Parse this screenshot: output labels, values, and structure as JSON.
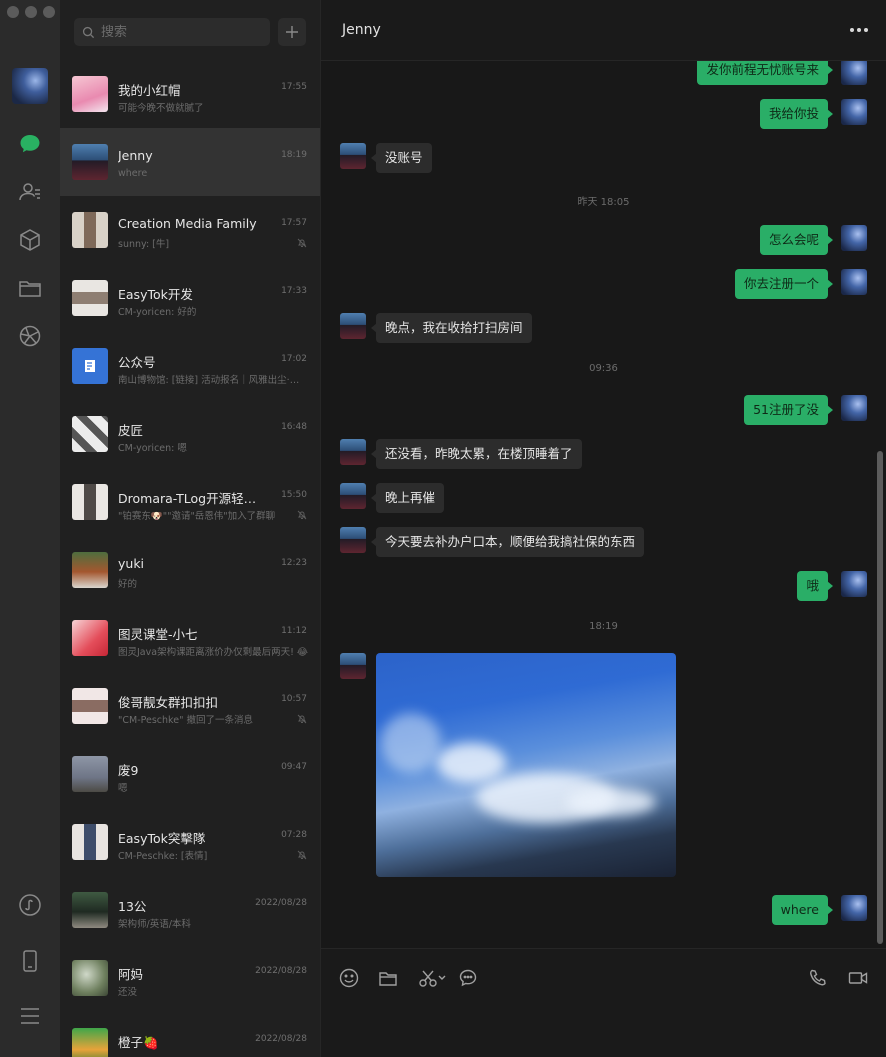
{
  "sidebar": {
    "nav_icons": [
      "avatar",
      "chat-icon",
      "contacts-icon",
      "favorites-cube-icon",
      "folder-icon",
      "moments-aperture-icon",
      "mini-program-icon",
      "phone-icon",
      "menu-icon"
    ]
  },
  "search": {
    "placeholder": "搜索",
    "add_label": "+"
  },
  "conversations": [
    {
      "name": "我的小红帽",
      "time": "17:55",
      "preview": "可能今晚不做就腻了",
      "muted": false
    },
    {
      "name": "Jenny",
      "time": "18:19",
      "preview": "where",
      "muted": false,
      "active": true
    },
    {
      "name": "Creation Media Family",
      "time": "17:57",
      "preview": "sunny: [牛]",
      "muted": true
    },
    {
      "name": "EasyTok开发",
      "time": "17:33",
      "preview": "CM-yoricen: 好的",
      "muted": false
    },
    {
      "name": "公众号",
      "time": "17:02",
      "preview": "南山博物馆: [链接] 活动报名｜风雅出尘·云...",
      "muted": false
    },
    {
      "name": "皮匠",
      "time": "16:48",
      "preview": "CM-yoricen: 嗯",
      "muted": false
    },
    {
      "name": "Dromara-TLog开源轻量级日...",
      "time": "15:50",
      "preview": "\"铂赛东🐶\"\"邀请\"岳恩伟\"加入了群聊",
      "muted": true
    },
    {
      "name": "yuki",
      "time": "12:23",
      "preview": "好的",
      "muted": false
    },
    {
      "name": "图灵课堂-小七",
      "time": "11:12",
      "preview": "图灵Java架构课距离涨价办仅剩最后两天! 😂",
      "muted": false
    },
    {
      "name": "俊哥靓女群扣扣扣",
      "time": "10:57",
      "preview": "\"CM-Peschke\" 撤回了一条消息",
      "muted": true
    },
    {
      "name": "废9",
      "time": "09:47",
      "preview": "嗯",
      "muted": false
    },
    {
      "name": "EasyTok突擊隊",
      "time": "07:28",
      "preview": "CM-Peschke: [表情]",
      "muted": true
    },
    {
      "name": "13公",
      "time": "2022/08/28",
      "preview": "架构师/英语/本科",
      "muted": false
    },
    {
      "name": "阿妈",
      "time": "2022/08/28",
      "preview": "还没",
      "muted": false
    },
    {
      "name": "橙子🍓",
      "time": "2022/08/28",
      "preview": "",
      "muted": false
    }
  ],
  "chat": {
    "title": "Jenny",
    "messages": [
      {
        "text": "发你前程无忧账号来",
        "dir": "out"
      },
      {
        "text": "我给你投",
        "dir": "out"
      },
      {
        "text": "没账号",
        "dir": "in"
      },
      {
        "text": "昨天 18:05",
        "dir": "time"
      },
      {
        "text": "怎么会呢",
        "dir": "out"
      },
      {
        "text": "你去注册一个",
        "dir": "out"
      },
      {
        "text": "晚点，我在收拾打扫房间",
        "dir": "in"
      },
      {
        "text": "09:36",
        "dir": "time"
      },
      {
        "text": "51注册了没",
        "dir": "out"
      },
      {
        "text": "还没看，昨晚太累，在楼顶睡着了",
        "dir": "in"
      },
      {
        "text": "晚上再催",
        "dir": "in"
      },
      {
        "text": "今天要去补办户口本，顺便给我搞社保的东西",
        "dir": "in"
      },
      {
        "text": "哦",
        "dir": "out"
      },
      {
        "text": "18:19",
        "dir": "time"
      },
      {
        "text": "where",
        "dir": "out"
      }
    ]
  },
  "composer": {
    "tools": [
      "emoji-icon",
      "folder-icon",
      "scissors-icon",
      "chat-history-icon",
      "voice-call-icon",
      "video-call-icon"
    ]
  },
  "colors": {
    "accent": "#2aae67",
    "sidebar": "#2b2b2b",
    "list": "#202020",
    "chat": "#181818"
  }
}
